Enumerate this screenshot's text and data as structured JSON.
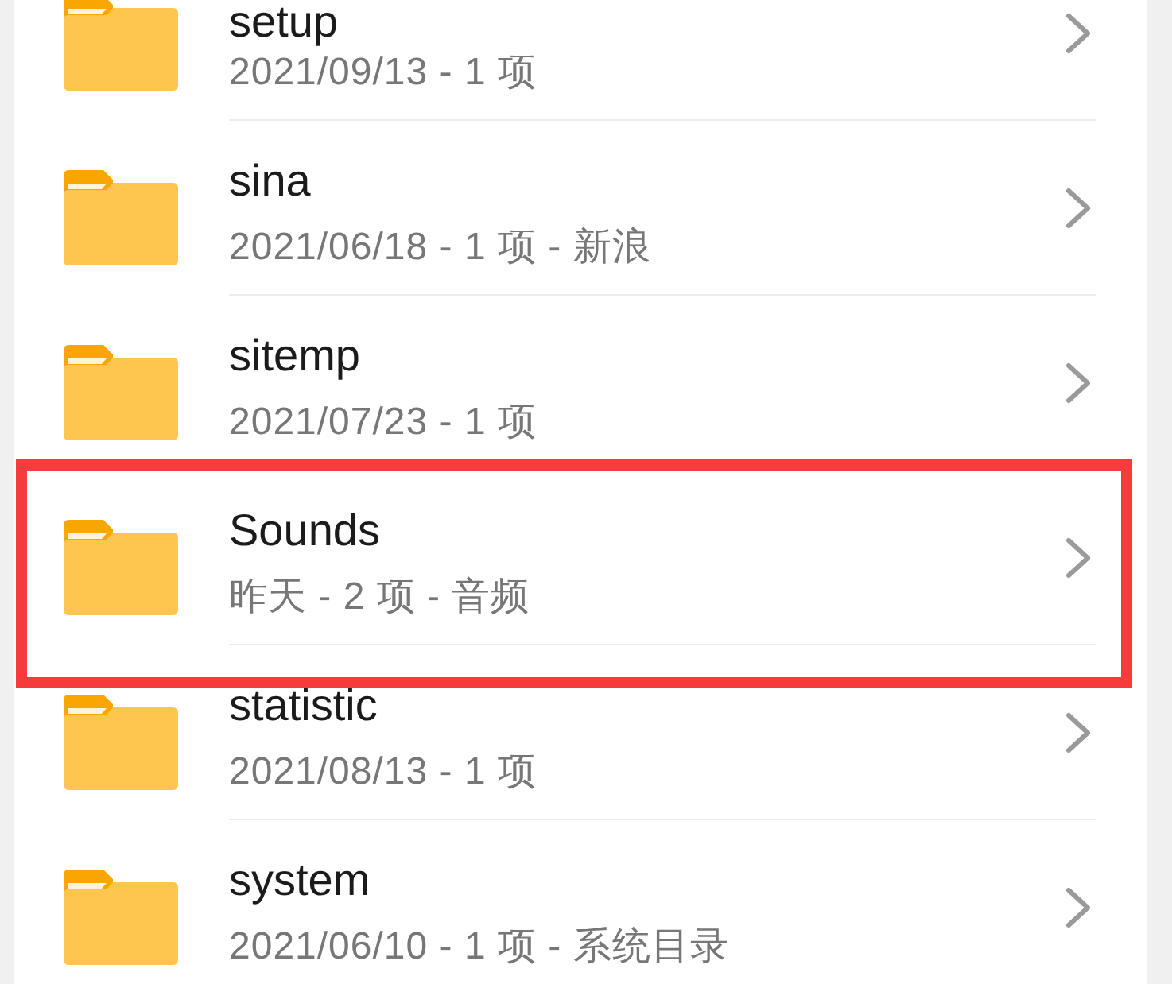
{
  "folders": [
    {
      "name": "setup",
      "details": "2021/09/13 - 1 项",
      "highlighted": false
    },
    {
      "name": "sina",
      "details": "2021/06/18 - 1 项 - 新浪",
      "highlighted": false
    },
    {
      "name": "sitemp",
      "details": "2021/07/23 - 1 项",
      "highlighted": false
    },
    {
      "name": "Sounds",
      "details": "昨天 - 2 项 - 音频",
      "highlighted": true
    },
    {
      "name": "statistic",
      "details": "2021/08/13 - 1 项",
      "highlighted": false
    },
    {
      "name": "system",
      "details": "2021/06/10 - 1 项 - 系统目录",
      "highlighted": false
    }
  ]
}
